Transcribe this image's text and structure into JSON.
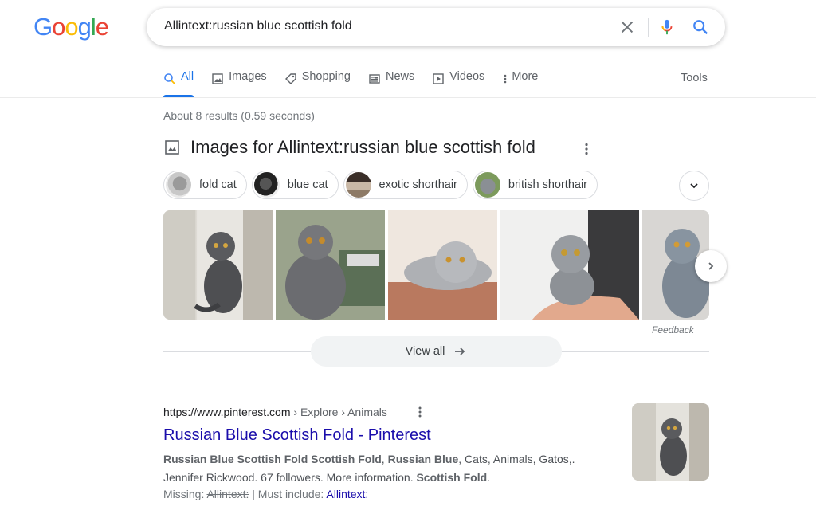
{
  "logo": {
    "letters": [
      "G",
      "o",
      "o",
      "g",
      "l",
      "e"
    ],
    "colors": [
      "#4285f4",
      "#ea4335",
      "#fbbc05",
      "#4285f4",
      "#34a853",
      "#ea4335"
    ]
  },
  "search": {
    "query": "Allintext:russian blue scottish fold"
  },
  "tabs": [
    {
      "label": "All",
      "icon": "search-icon",
      "active": true
    },
    {
      "label": "Images",
      "icon": "image-icon"
    },
    {
      "label": "Shopping",
      "icon": "tag-icon"
    },
    {
      "label": "News",
      "icon": "newspaper-icon"
    },
    {
      "label": "Videos",
      "icon": "play-icon"
    },
    {
      "label": "More",
      "icon": "more-vert-icon"
    }
  ],
  "tools_label": "Tools",
  "stats": "About 8 results (0.59 seconds)",
  "images_block": {
    "title": "Images for Allintext:russian blue scottish fold",
    "chips": [
      {
        "label": "fold cat"
      },
      {
        "label": "blue cat"
      },
      {
        "label": "exotic shorthair"
      },
      {
        "label": "british shorthair"
      }
    ],
    "feedback": "Feedback",
    "view_all": "View all"
  },
  "result": {
    "url": "https://www.pinterest.com",
    "breadcrumb": " › Explore › Animals",
    "title": "Russian Blue Scottish Fold - Pinterest",
    "snippet_b1": "Russian Blue Scottish Fold Scottish Fold",
    "snippet_t1": ", ",
    "snippet_b2": "Russian Blue",
    "snippet_t2": ", Cats, Animals, Gatos,.",
    "snippet_t3": "Jennifer Rickwood. 67 followers. More information. ",
    "snippet_b3": "Scottish Fold",
    "snippet_t4": ".",
    "missing_label": "Missing: ",
    "missing_term": "Allintext:",
    "must_include_label": " | Must include: ",
    "must_include_term": "Allintext:"
  },
  "colors": {
    "accent": "#1a73e8",
    "link": "#1a0dab"
  }
}
